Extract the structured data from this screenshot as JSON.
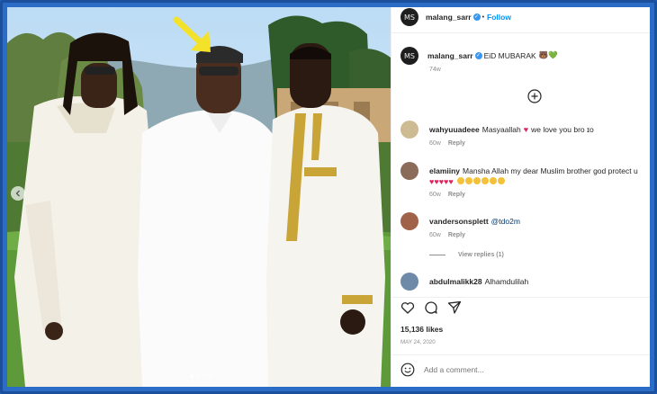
{
  "post": {
    "username": "malang_sarr",
    "follow_label": "Follow",
    "caption": "EiD MUBARAK",
    "caption_emojis": "🐻💚",
    "caption_time": "74w",
    "likes": "15,136 likes",
    "date": "MAY 24, 2020",
    "add_comment_placeholder": "Add a comment..."
  },
  "comments": [
    {
      "username": "wahyuuadeee",
      "text": "Masyaallah",
      "text_after": "we love you bro ɪo",
      "time": "60w",
      "reply": "Reply"
    },
    {
      "username": "elamiiny",
      "text": "Mansha Allah my dear Muslim brother god protect u",
      "time": "60w",
      "reply": "Reply"
    },
    {
      "username": "vandersonsplett",
      "text": "@tdo2m",
      "time": "60w",
      "reply": "Reply",
      "view_replies": "View replies (1)"
    },
    {
      "username": "abdulmalikk28",
      "text": "Alhamdulilah"
    }
  ],
  "icons": {
    "avatar_letters": "MS",
    "more_comments": "plus-circle-icon",
    "like": "heart-icon",
    "comment": "comment-icon",
    "share": "send-icon",
    "emoji": "smiley-icon",
    "carousel_left": "chevron-left-icon"
  },
  "colors": {
    "link": "#0095f6",
    "heart": "#e0245e",
    "frame": "#1c4f9c"
  }
}
